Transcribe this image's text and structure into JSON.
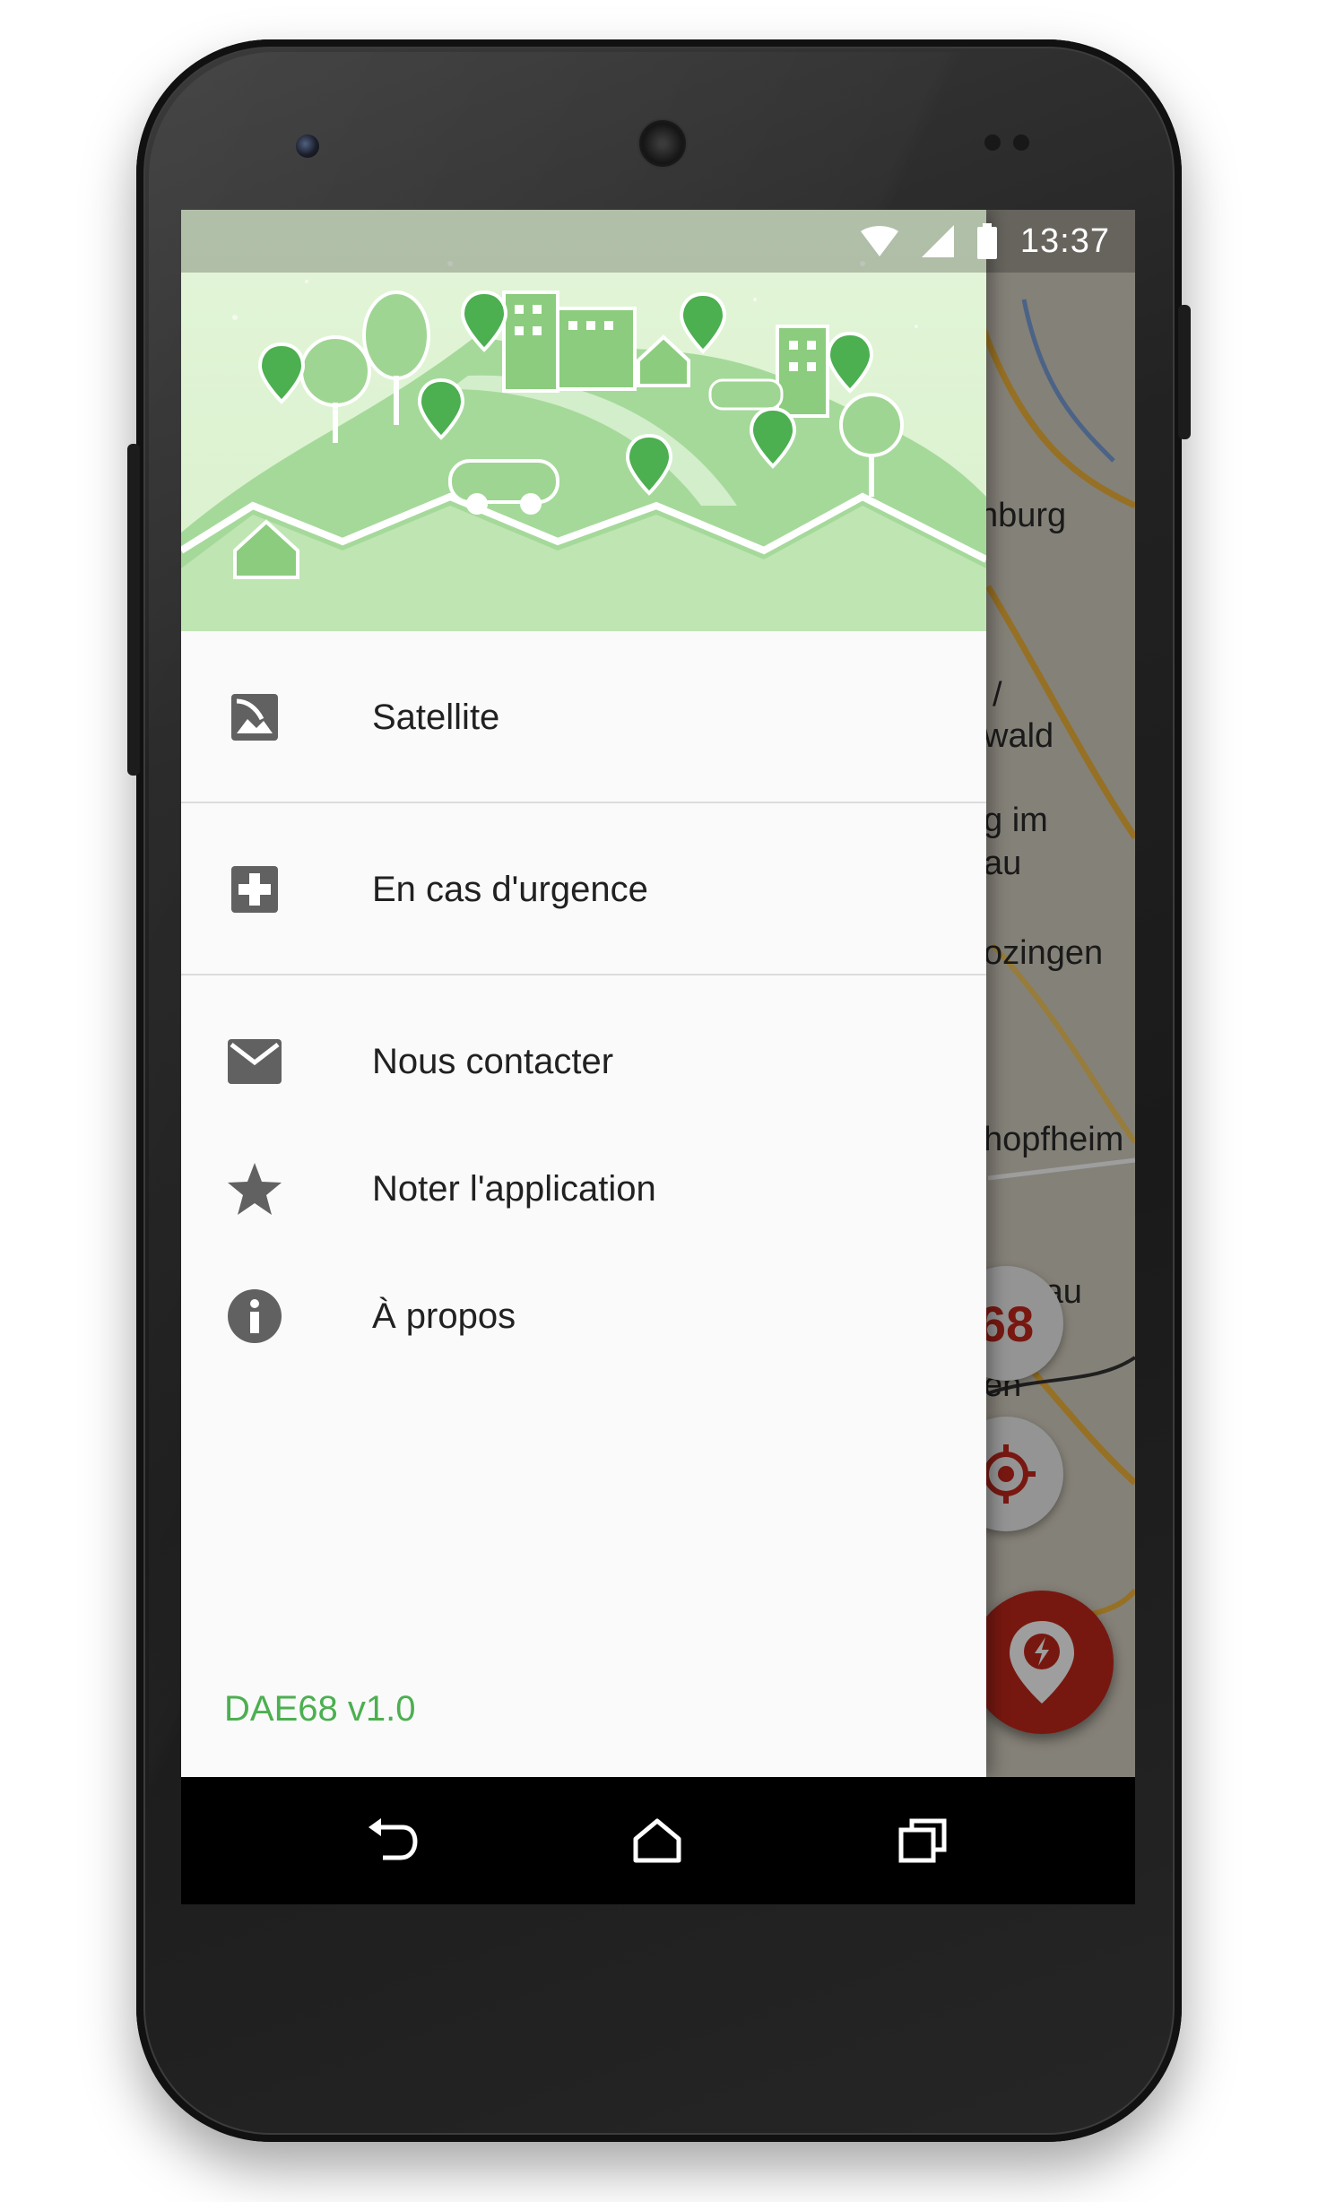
{
  "status_bar": {
    "time": "13:37"
  },
  "map": {
    "labels": [
      "nburg",
      "/",
      "wald",
      "g im",
      "au",
      "ozingen",
      "hopfheim",
      "rau",
      "en"
    ],
    "badge_text": "68"
  },
  "drawer": {
    "items": [
      {
        "label": "Satellite",
        "icon": "image-icon"
      },
      {
        "label": "En cas d'urgence",
        "icon": "medical-cross-icon"
      },
      {
        "label": "Nous contacter",
        "icon": "mail-icon"
      },
      {
        "label": "Noter l'application",
        "icon": "star-icon"
      },
      {
        "label": "À propos",
        "icon": "info-icon"
      }
    ],
    "version": "DAE68 v1.0"
  },
  "colors": {
    "accent_green": "#4caf50",
    "header_green": "#d9f1cc",
    "fab_red": "#c0281a",
    "icon_grey": "#616161"
  }
}
